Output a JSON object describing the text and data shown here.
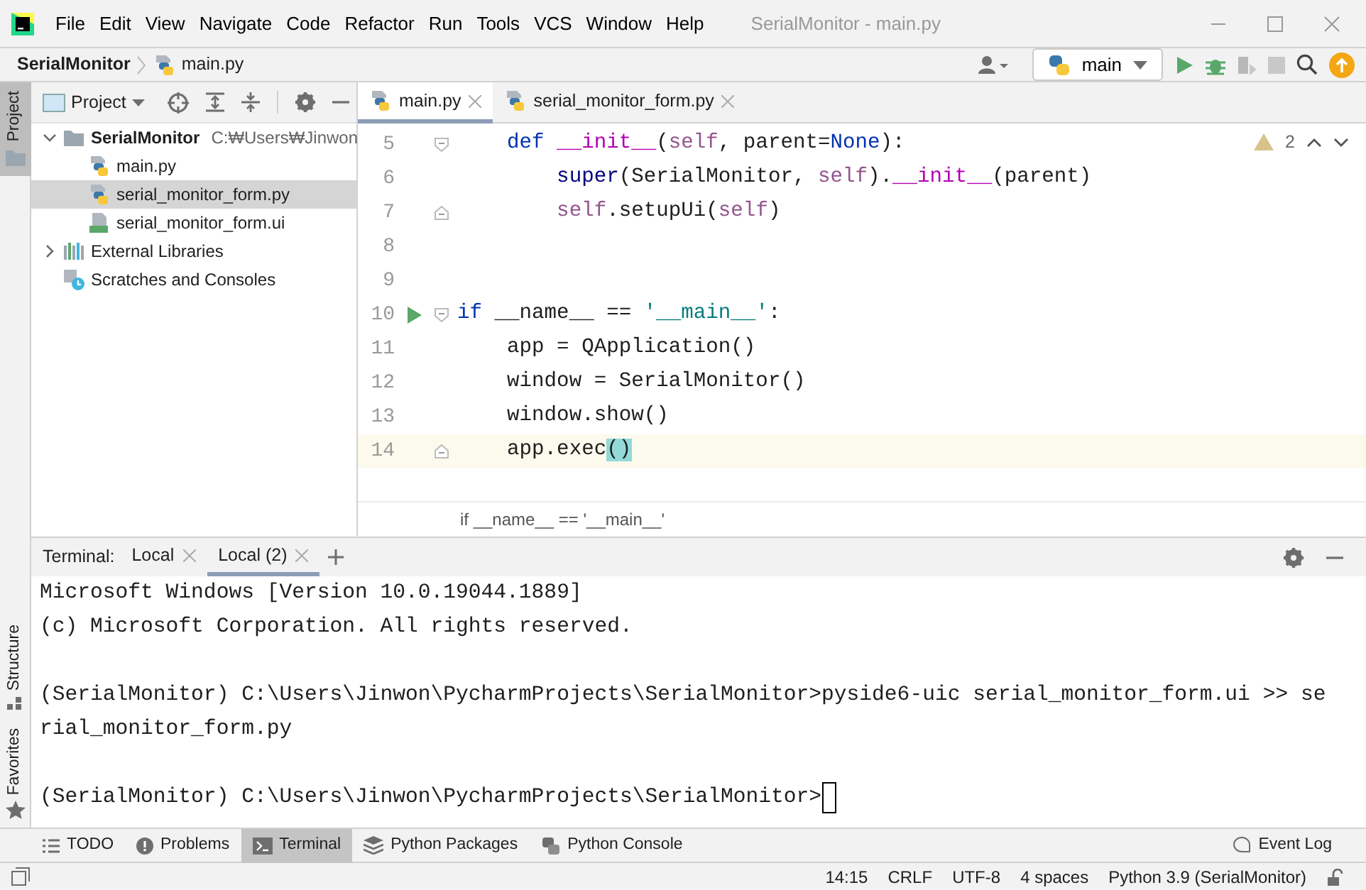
{
  "menu": [
    "File",
    "Edit",
    "View",
    "Navigate",
    "Code",
    "Refactor",
    "Run",
    "Tools",
    "VCS",
    "Window",
    "Help"
  ],
  "window_title": "SerialMonitor - main.py",
  "breadcrumb": [
    {
      "label": "SerialMonitor",
      "kind": "project"
    },
    {
      "label": "main.py",
      "kind": "python"
    }
  ],
  "run_config": "main",
  "side_tools_top": [
    {
      "label": "Project",
      "kind": "folder",
      "selected": true
    }
  ],
  "side_tools_bottom": [
    {
      "label": "Structure",
      "kind": "structure",
      "selected": false
    },
    {
      "label": "Favorites",
      "kind": "star",
      "selected": false
    }
  ],
  "project_panel": {
    "title": "Project",
    "tree": [
      {
        "label": "SerialMonitor",
        "path": "C:₩Users₩Jinwon",
        "kind": "folder",
        "expanded": true,
        "selected": false,
        "children": [
          {
            "label": "main.py",
            "kind": "python",
            "selected": false
          },
          {
            "label": "serial_monitor_form.py",
            "kind": "python",
            "selected": true
          },
          {
            "label": "serial_monitor_form.ui",
            "kind": "qt",
            "selected": false
          }
        ]
      },
      {
        "label": "External Libraries",
        "kind": "libraries",
        "expanded": false,
        "selected": false
      },
      {
        "label": "Scratches and Consoles",
        "kind": "scratches",
        "selected": false
      }
    ]
  },
  "editor_tabs": [
    {
      "label": "main.py",
      "selected": true
    },
    {
      "label": "serial_monitor_form.py",
      "selected": false
    }
  ],
  "warnings": "2",
  "code_lines": [
    {
      "number": "5",
      "fold_start": true,
      "tokens": [
        {
          "text": "    def ",
          "kind": "keyword"
        },
        {
          "text": "__init__",
          "kind": "magic"
        },
        {
          "text": "(",
          "kind": "plain"
        },
        {
          "text": "self",
          "kind": "self"
        },
        {
          "text": ", parent=",
          "kind": "plain"
        },
        {
          "text": "None",
          "kind": "keyword"
        },
        {
          "text": "):",
          "kind": "plain"
        }
      ]
    },
    {
      "number": "6",
      "tokens": [
        {
          "text": "        super",
          "kind": "builtin"
        },
        {
          "text": "(SerialMonitor, ",
          "kind": "plain"
        },
        {
          "text": "self",
          "kind": "self"
        },
        {
          "text": ").",
          "kind": "plain"
        },
        {
          "text": "__init__",
          "kind": "magic"
        },
        {
          "text": "(parent)",
          "kind": "plain"
        }
      ]
    },
    {
      "number": "7",
      "fold_end": true,
      "tokens": [
        {
          "text": "        self",
          "kind": "self"
        },
        {
          "text": ".setupUi(",
          "kind": "plain"
        },
        {
          "text": "self",
          "kind": "self"
        },
        {
          "text": ")",
          "kind": "plain"
        }
      ]
    },
    {
      "number": "8"
    },
    {
      "number": "9"
    },
    {
      "number": "10",
      "run_marker": true,
      "fold_start": true,
      "tokens": [
        {
          "text": "if",
          "kind": "keyword"
        },
        {
          "text": " __name__ == ",
          "kind": "plain"
        },
        {
          "text": "'__main__'",
          "kind": "string"
        },
        {
          "text": ":",
          "kind": "plain"
        }
      ]
    },
    {
      "number": "11",
      "tokens": [
        {
          "text": "    app = QApplication()",
          "kind": "plain"
        }
      ]
    },
    {
      "number": "12",
      "tokens": [
        {
          "text": "    window = SerialMonitor()",
          "kind": "plain"
        }
      ]
    },
    {
      "number": "13",
      "tokens": [
        {
          "text": "    window.show()",
          "kind": "plain"
        }
      ]
    },
    {
      "number": "14",
      "fold_end": true,
      "current": true,
      "tokens": [
        {
          "text": "    app.exec",
          "kind": "plain"
        },
        {
          "text": "()",
          "kind": "matched"
        }
      ]
    }
  ],
  "editor_footer": "if __name__ == '__main__'",
  "terminal": {
    "label": "Terminal:",
    "tabs": [
      {
        "label": "Local",
        "selected": false
      },
      {
        "label": "Local (2)",
        "selected": true
      }
    ],
    "lines": [
      {
        "text": "Microsoft Windows [Version 10.0.19044.1889]"
      },
      {
        "text": "(c) Microsoft Corporation. All rights reserved."
      },
      {
        "kind": "blank"
      },
      {
        "text": "(SerialMonitor) C:\\Users\\Jinwon\\PycharmProjects\\SerialMonitor>pyside6-uic serial_monitor_form.ui >> se"
      },
      {
        "text": "rial_monitor_form.py"
      },
      {
        "kind": "blank"
      },
      {
        "text": "(SerialMonitor) C:\\Users\\Jinwon\\PycharmProjects\\SerialMonitor>",
        "cursor": true
      }
    ]
  },
  "bottom_tools": [
    {
      "label": "TODO",
      "kind": "todo",
      "selected": false
    },
    {
      "label": "Problems",
      "kind": "problems",
      "selected": false
    },
    {
      "label": "Terminal",
      "kind": "terminal",
      "selected": true
    },
    {
      "label": "Python Packages",
      "kind": "packages",
      "selected": false
    },
    {
      "label": "Python Console",
      "kind": "console",
      "selected": false
    }
  ],
  "event_log": "Event Log",
  "status_bar": [
    "14:15",
    "CRLF",
    "UTF-8",
    "4 spaces",
    "Python 3.9 (SerialMonitor)"
  ]
}
